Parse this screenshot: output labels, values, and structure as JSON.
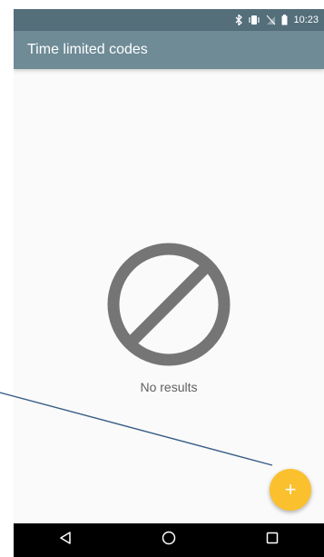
{
  "status_bar": {
    "time": "10:23",
    "icons": [
      "bluetooth-icon",
      "vibrate-icon",
      "no-signal-icon",
      "battery-icon"
    ]
  },
  "app_bar": {
    "title": "Time limited codes"
  },
  "empty_state": {
    "icon": "no-results-icon",
    "label": "No results"
  },
  "fab": {
    "icon": "add-icon",
    "label": "+"
  },
  "nav_bar": {
    "buttons": [
      "back-icon",
      "home-icon",
      "recents-icon"
    ]
  },
  "colors": {
    "status_bar": "#546e7a",
    "app_bar": "#6e8b96",
    "fab": "#fbc02d",
    "empty_icon": "#757575"
  }
}
